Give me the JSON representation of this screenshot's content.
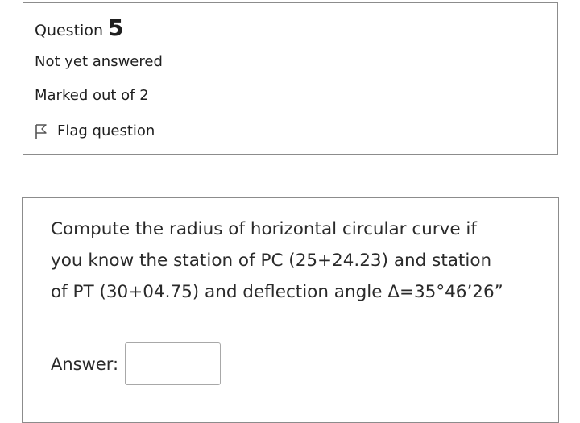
{
  "info": {
    "question_label": "Question",
    "question_number": "5",
    "state": "Not yet answered",
    "grade": "Marked out of 2",
    "flag_label": "Flag question"
  },
  "question": {
    "line1": "Compute the radius of horizontal circular curve if",
    "line2": "you know the station of PC (25+24.23) and station",
    "line3": "of PT (30+04.75) and deflection angle Δ=35°46ʼ26ˮ",
    "answer_label": "Answer:",
    "answer_value": ""
  }
}
